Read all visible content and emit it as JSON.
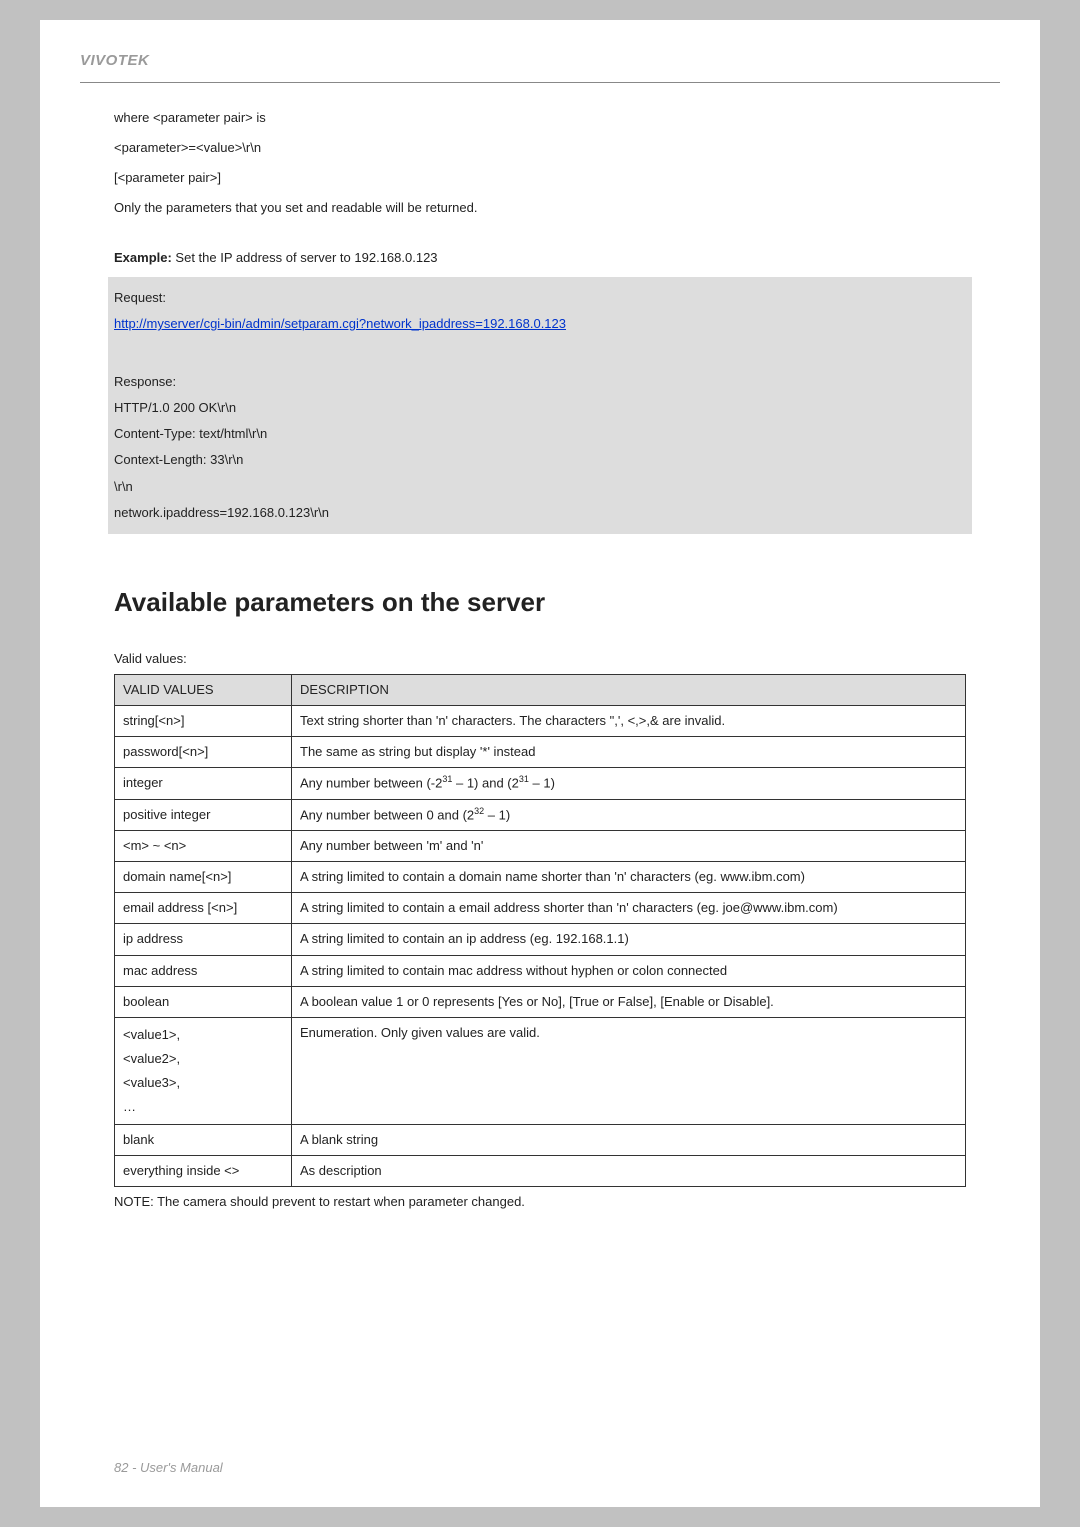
{
  "brand": "VIVOTEK",
  "intro": {
    "w1": "where <parameter pair> is",
    "w2": "<parameter>=<value>\\r\\n",
    "w3": "[<parameter pair>]",
    "w4": "Only the parameters that you set and readable will be returned."
  },
  "example": {
    "label": "Example:",
    "text": " Set the IP address of server to 192.168.0.123",
    "box": {
      "l1": "Request:",
      "url": "http://myserver/cgi-bin/admin/setparam.cgi?network_ipaddress=192.168.0.123",
      "l2": "Response:",
      "l3": "HTTP/1.0 200 OK\\r\\n",
      "l4": "Content-Type: text/html\\r\\n",
      "l5": "Context-Length: 33\\r\\n",
      "l6": "\\r\\n",
      "l7": "network.ipaddress=192.168.0.123\\r\\n"
    }
  },
  "section_title": "Available parameters on the server",
  "valid_label": "Valid values:",
  "table": {
    "h1": "VALID VALUES",
    "h2": "DESCRIPTION",
    "rows": [
      {
        "v": "string[<n>]",
        "d": "Text string shorter than 'n' characters. The characters \",', <,>,& are invalid."
      },
      {
        "v": "password[<n>]",
        "d": "The same as string but display '*' instead"
      },
      {
        "v": "integer",
        "d_html": "Any number between (-2<sup>31</sup> – 1) and (2<sup>31</sup> – 1)"
      },
      {
        "v": "positive integer",
        "d_html": "Any number between 0 and (2<sup>32</sup> – 1)"
      },
      {
        "v": "<m> ~ <n>",
        "d": "Any number between 'm' and 'n'"
      },
      {
        "v": "domain name[<n>]",
        "d": "A string limited to contain a domain name shorter than 'n' characters (eg. www.ibm.com)"
      },
      {
        "v": "email address [<n>]",
        "d": "A string limited to contain a email address shorter than 'n' characters (eg. joe@www.ibm.com)"
      },
      {
        "v": "ip address",
        "d": "A string limited to contain an ip address (eg. 192.168.1.1)"
      },
      {
        "v": "mac address",
        "d": "A string limited to contain mac address without hyphen or colon connected"
      },
      {
        "v": "boolean",
        "d": "A boolean value 1 or 0 represents [Yes or No], [True or False], [Enable or Disable]."
      },
      {
        "v_multi": [
          "<value1>,",
          "<value2>,",
          "<value3>,",
          "…"
        ],
        "d": "Enumeration. Only given values are valid."
      },
      {
        "v": "blank",
        "d": "A blank string"
      },
      {
        "v": "everything inside <>",
        "d": "As description"
      }
    ]
  },
  "note": "NOTE: The camera should prevent to restart when parameter changed.",
  "footer": "82 - User's Manual"
}
